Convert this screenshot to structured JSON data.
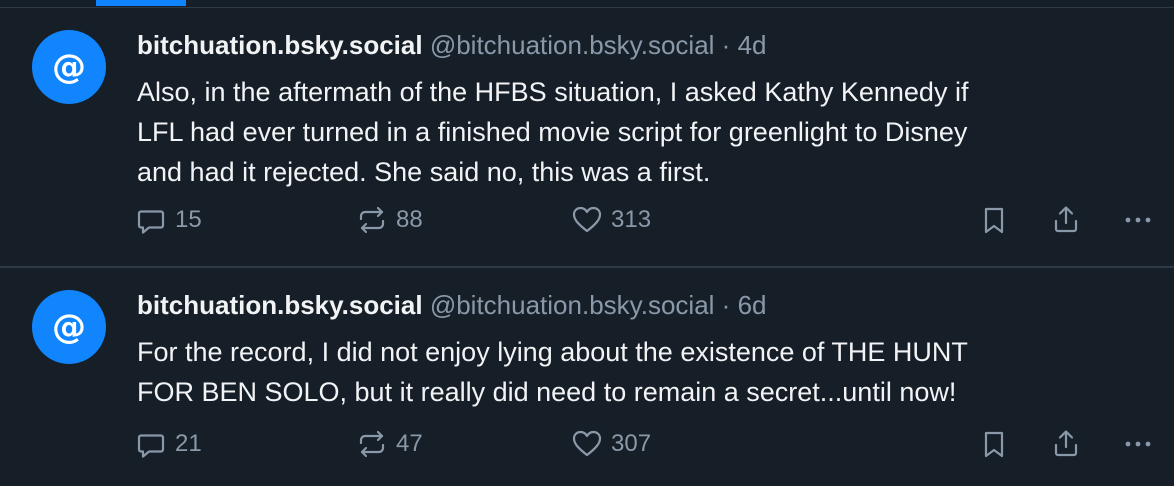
{
  "feed": {
    "posts": [
      {
        "avatar_glyph": "@",
        "display_name": "bitchuation.bsky.social",
        "handle": "@bitchuation.bsky.social",
        "separator": "·",
        "time": "4d",
        "text": "Also, in the aftermath of the HFBS situation, I asked Kathy Kennedy if\nLFL had ever turned in a finished movie script for greenlight to Disney\nand had it rejected. She said no, this was a first.",
        "replies": "15",
        "reposts": "88",
        "likes": "313"
      },
      {
        "avatar_glyph": "@",
        "display_name": "bitchuation.bsky.social",
        "handle": "@bitchuation.bsky.social",
        "separator": "·",
        "time": "6d",
        "text": "For the record, I did not enjoy lying about the existence of THE HUNT\nFOR BEN SOLO, but it really did need to remain a secret...until now!",
        "replies": "21",
        "reposts": "47",
        "likes": "307"
      }
    ]
  },
  "icons": {
    "reply": "reply-icon",
    "repost": "repost-icon",
    "like": "heart-icon",
    "bookmark": "bookmark-icon",
    "share": "share-icon",
    "more": "more-icon"
  },
  "colors": {
    "background": "#161e27",
    "accent": "#1185fe",
    "text_primary": "#f1f3f5",
    "text_secondary": "#8a99a9",
    "divider": "#2e3a48"
  }
}
